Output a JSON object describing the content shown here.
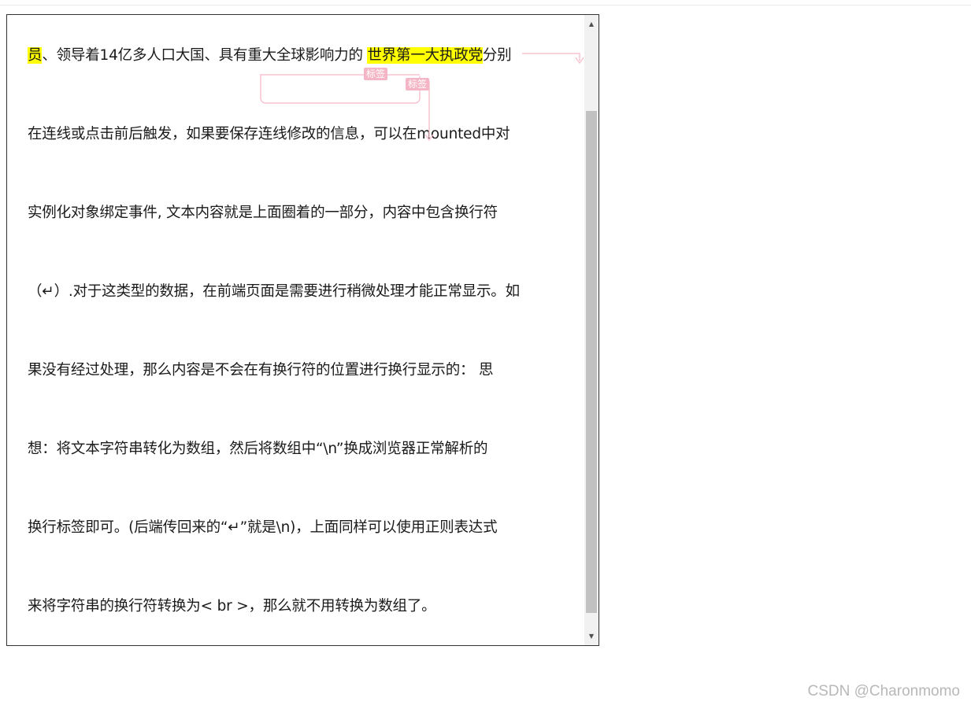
{
  "document": {
    "lines": [
      {
        "pre": "员",
        "mid": "、领导着14亿多人口大国、具有重大全球影响力的 ",
        "hl": "世界第一大执政党",
        "post": "分别"
      },
      {
        "text": "在连线或点击前后触发，如果要保存连线修改的信息，可以在mounted中对"
      },
      {
        "text": "实例化对象绑定事件, 文本内容就是上面圈着的一部分，内容中包含换行符"
      },
      {
        "text": "（↵）.对于这类型的数据，在前端页面是需要进行稍微处理才能正常显示。如"
      },
      {
        "text": "果没有经过处理，那么内容是不会在有换行符的位置进行换行显示的： 思"
      },
      {
        "text": "想：将文本字符串转化为数组，然后将数组中“\\n”换成浏览器正常解析的"
      },
      {
        "text": "换行标签即可。(后端传回来的“↵”就是\\n)，上面同样可以使用正则表达式"
      },
      {
        "text": "来将字符串的换行符转换为< br >，那么就不用转换为数组了。"
      }
    ],
    "tags": [
      "标签",
      "标签"
    ]
  },
  "scrollbar": {
    "up_glyph": "▲",
    "down_glyph": "▼"
  },
  "watermark": "CSDN @Charonmomo",
  "colors": {
    "highlight": "#ffff00",
    "connector": "#f4b6c6",
    "border": "#333333"
  }
}
